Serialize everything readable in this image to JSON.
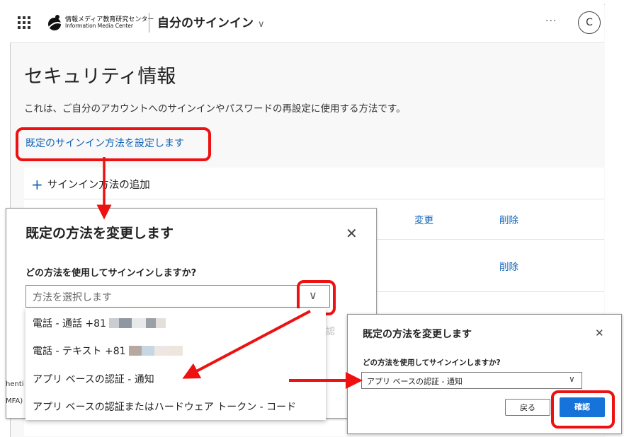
{
  "header": {
    "org_name_jp": "情報メディア教育研究センター",
    "org_name_en": "Information Media Center",
    "app_title": "自分のサインイン",
    "more_label": "···",
    "avatar_initial": "C"
  },
  "page": {
    "title": "セキュリティ情報",
    "description": "これは、ご自分のアカウントへのサインインやパスワードの再設定に使用する方法です。",
    "default_method_link": "既定のサインイン方法を設定します"
  },
  "methods_card": {
    "add_method_label": "サインイン方法の追加",
    "rows": [
      {
        "change_label": "変更",
        "delete_label": "削除"
      },
      {
        "delete_label": "削除"
      }
    ],
    "clipped_texts": [
      "henti",
      "MFA)"
    ]
  },
  "dialog_dropdown": {
    "title": "既定の方法を変更します",
    "close_icon": "close-icon",
    "question": "どの方法を使用してサインインしますか?",
    "placeholder": "方法を選択します",
    "options": [
      "電話 - 通話 +81",
      "電話 - テキスト +81",
      "アプリ ベースの認証 - 通知",
      "アプリ ベースの認証またはハードウェア トークン - コード"
    ],
    "hidden_button_fragment": "認"
  },
  "dialog_confirm": {
    "title": "既定の方法を変更します",
    "question": "どの方法を使用してサインインしますか?",
    "selected_value": "アプリ ベースの認証 - 通知",
    "back_label": "戻る",
    "confirm_label": "確認"
  },
  "colors": {
    "accent_blue": "#0f63b8",
    "primary_button": "#1673d9",
    "highlight_red": "#ee1111"
  }
}
